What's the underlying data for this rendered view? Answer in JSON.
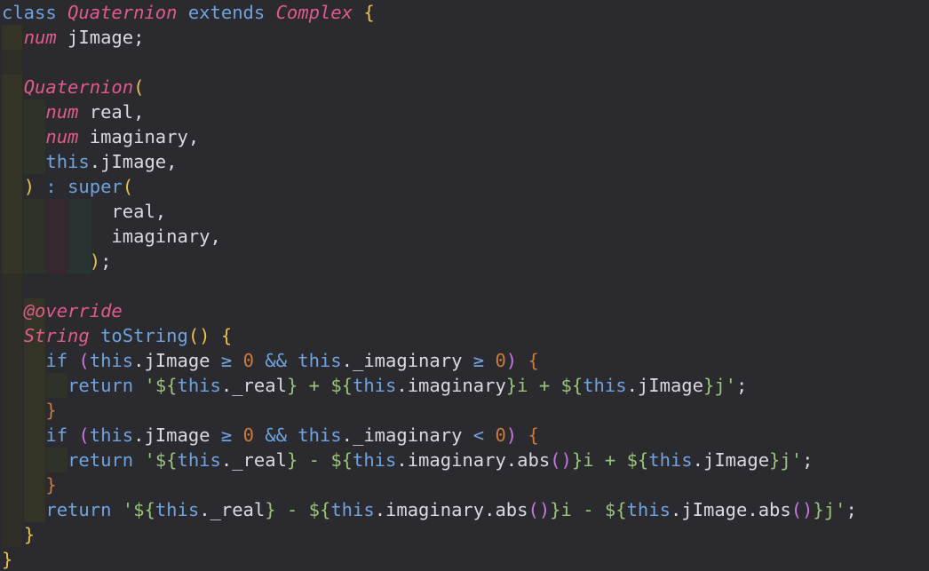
{
  "code_lines": [
    [
      {
        "t": "class",
        "c": "kw"
      },
      {
        "t": " ",
        "c": "id"
      },
      {
        "t": "Quaternion",
        "c": "type"
      },
      {
        "t": " ",
        "c": "id"
      },
      {
        "t": "extends",
        "c": "kw"
      },
      {
        "t": " ",
        "c": "id"
      },
      {
        "t": "Complex",
        "c": "type"
      },
      {
        "t": " ",
        "c": "id"
      },
      {
        "t": "{",
        "c": "brace"
      }
    ],
    [
      {
        "t": "  ",
        "c": "id"
      },
      {
        "t": "num",
        "c": "type"
      },
      {
        "t": " jImage;",
        "c": "id"
      }
    ],
    [],
    [
      {
        "t": "  ",
        "c": "id"
      },
      {
        "t": "Quaternion",
        "c": "type"
      },
      {
        "t": "(",
        "c": "brace"
      }
    ],
    [
      {
        "t": "    ",
        "c": "id"
      },
      {
        "t": "num",
        "c": "type"
      },
      {
        "t": " real,",
        "c": "id"
      }
    ],
    [
      {
        "t": "    ",
        "c": "id"
      },
      {
        "t": "num",
        "c": "type"
      },
      {
        "t": " imaginary,",
        "c": "id"
      }
    ],
    [
      {
        "t": "    ",
        "c": "id"
      },
      {
        "t": "this",
        "c": "kw"
      },
      {
        "t": ".jImage,",
        "c": "id"
      }
    ],
    [
      {
        "t": "  ",
        "c": "id"
      },
      {
        "t": ")",
        "c": "brace"
      },
      {
        "t": " : ",
        "c": "op"
      },
      {
        "t": "super",
        "c": "kw"
      },
      {
        "t": "(",
        "c": "brace"
      }
    ],
    [
      {
        "t": "          real,",
        "c": "id"
      }
    ],
    [
      {
        "t": "          imaginary,",
        "c": "id"
      }
    ],
    [
      {
        "t": "        ",
        "c": "id"
      },
      {
        "t": ")",
        "c": "brace"
      },
      {
        "t": ";",
        "c": "id"
      }
    ],
    [],
    [
      {
        "t": "  ",
        "c": "id"
      },
      {
        "t": "@override",
        "c": "ann"
      }
    ],
    [
      {
        "t": "  ",
        "c": "id"
      },
      {
        "t": "String",
        "c": "type"
      },
      {
        "t": " ",
        "c": "id"
      },
      {
        "t": "toString",
        "c": "fn"
      },
      {
        "t": "()",
        "c": "brace"
      },
      {
        "t": " ",
        "c": "id"
      },
      {
        "t": "{",
        "c": "brace"
      }
    ],
    [
      {
        "t": "    ",
        "c": "id"
      },
      {
        "t": "if",
        "c": "kw"
      },
      {
        "t": " ",
        "c": "id"
      },
      {
        "t": "(",
        "c": "paren2"
      },
      {
        "t": "this",
        "c": "kw"
      },
      {
        "t": ".jImage ",
        "c": "id"
      },
      {
        "t": "≥",
        "c": "op"
      },
      {
        "t": " ",
        "c": "id"
      },
      {
        "t": "0",
        "c": "num"
      },
      {
        "t": " ",
        "c": "id"
      },
      {
        "t": "&&",
        "c": "op"
      },
      {
        "t": " ",
        "c": "id"
      },
      {
        "t": "this",
        "c": "kw"
      },
      {
        "t": "._imaginary ",
        "c": "id"
      },
      {
        "t": "≥",
        "c": "op"
      },
      {
        "t": " ",
        "c": "id"
      },
      {
        "t": "0",
        "c": "num"
      },
      {
        "t": ")",
        "c": "paren2"
      },
      {
        "t": " ",
        "c": "id"
      },
      {
        "t": "{",
        "c": "num"
      }
    ],
    [
      {
        "t": "      ",
        "c": "id"
      },
      {
        "t": "return",
        "c": "kw"
      },
      {
        "t": " ",
        "c": "id"
      },
      {
        "t": "'",
        "c": "str"
      },
      {
        "t": "${",
        "c": "str"
      },
      {
        "t": "this",
        "c": "kw"
      },
      {
        "t": "._real",
        "c": "id"
      },
      {
        "t": "}",
        "c": "str"
      },
      {
        "t": " + ",
        "c": "str"
      },
      {
        "t": "${",
        "c": "str"
      },
      {
        "t": "this",
        "c": "kw"
      },
      {
        "t": ".imaginary",
        "c": "id"
      },
      {
        "t": "}",
        "c": "str"
      },
      {
        "t": "i + ",
        "c": "str"
      },
      {
        "t": "${",
        "c": "str"
      },
      {
        "t": "this",
        "c": "kw"
      },
      {
        "t": ".jImage",
        "c": "id"
      },
      {
        "t": "}",
        "c": "str"
      },
      {
        "t": "j'",
        "c": "str"
      },
      {
        "t": ";",
        "c": "id"
      }
    ],
    [
      {
        "t": "    ",
        "c": "id"
      },
      {
        "t": "}",
        "c": "num"
      }
    ],
    [
      {
        "t": "    ",
        "c": "id"
      },
      {
        "t": "if",
        "c": "kw"
      },
      {
        "t": " ",
        "c": "id"
      },
      {
        "t": "(",
        "c": "paren2"
      },
      {
        "t": "this",
        "c": "kw"
      },
      {
        "t": ".jImage ",
        "c": "id"
      },
      {
        "t": "≥",
        "c": "op"
      },
      {
        "t": " ",
        "c": "id"
      },
      {
        "t": "0",
        "c": "num"
      },
      {
        "t": " ",
        "c": "id"
      },
      {
        "t": "&&",
        "c": "op"
      },
      {
        "t": " ",
        "c": "id"
      },
      {
        "t": "this",
        "c": "kw"
      },
      {
        "t": "._imaginary ",
        "c": "id"
      },
      {
        "t": "<",
        "c": "op"
      },
      {
        "t": " ",
        "c": "id"
      },
      {
        "t": "0",
        "c": "num"
      },
      {
        "t": ")",
        "c": "paren2"
      },
      {
        "t": " ",
        "c": "id"
      },
      {
        "t": "{",
        "c": "num"
      }
    ],
    [
      {
        "t": "      ",
        "c": "id"
      },
      {
        "t": "return",
        "c": "kw"
      },
      {
        "t": " ",
        "c": "id"
      },
      {
        "t": "'",
        "c": "str"
      },
      {
        "t": "${",
        "c": "str"
      },
      {
        "t": "this",
        "c": "kw"
      },
      {
        "t": "._real",
        "c": "id"
      },
      {
        "t": "}",
        "c": "str"
      },
      {
        "t": " - ",
        "c": "str"
      },
      {
        "t": "${",
        "c": "str"
      },
      {
        "t": "this",
        "c": "kw"
      },
      {
        "t": ".imaginary.abs",
        "c": "id"
      },
      {
        "t": "()",
        "c": "paren2"
      },
      {
        "t": "}",
        "c": "str"
      },
      {
        "t": "i + ",
        "c": "str"
      },
      {
        "t": "${",
        "c": "str"
      },
      {
        "t": "this",
        "c": "kw"
      },
      {
        "t": ".jImage",
        "c": "id"
      },
      {
        "t": "}",
        "c": "str"
      },
      {
        "t": "j'",
        "c": "str"
      },
      {
        "t": ";",
        "c": "id"
      }
    ],
    [
      {
        "t": "    ",
        "c": "id"
      },
      {
        "t": "}",
        "c": "num"
      }
    ],
    [
      {
        "t": "    ",
        "c": "id"
      },
      {
        "t": "return",
        "c": "kw"
      },
      {
        "t": " ",
        "c": "id"
      },
      {
        "t": "'",
        "c": "str"
      },
      {
        "t": "${",
        "c": "str"
      },
      {
        "t": "this",
        "c": "kw"
      },
      {
        "t": "._real",
        "c": "id"
      },
      {
        "t": "}",
        "c": "str"
      },
      {
        "t": " - ",
        "c": "str"
      },
      {
        "t": "${",
        "c": "str"
      },
      {
        "t": "this",
        "c": "kw"
      },
      {
        "t": ".imaginary.abs",
        "c": "id"
      },
      {
        "t": "()",
        "c": "paren2"
      },
      {
        "t": "}",
        "c": "str"
      },
      {
        "t": "i - ",
        "c": "str"
      },
      {
        "t": "${",
        "c": "str"
      },
      {
        "t": "this",
        "c": "kw"
      },
      {
        "t": ".jImage.abs",
        "c": "id"
      },
      {
        "t": "()",
        "c": "paren2"
      },
      {
        "t": "}",
        "c": "str"
      },
      {
        "t": "j'",
        "c": "str"
      },
      {
        "t": ";",
        "c": "id"
      }
    ],
    [
      {
        "t": "  ",
        "c": "id"
      },
      {
        "t": "}",
        "c": "brace"
      }
    ],
    [
      {
        "t": "}",
        "c": "brace"
      }
    ]
  ]
}
